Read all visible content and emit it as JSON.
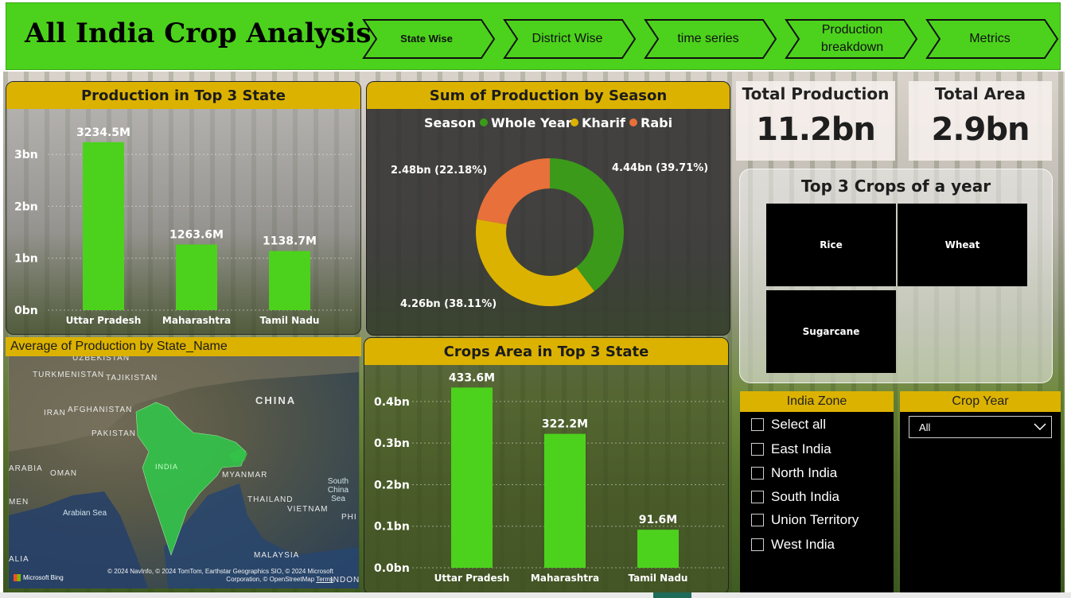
{
  "header": {
    "title": "All India Crop Analysis",
    "nav": [
      "State Wise",
      "District Wise",
      "time series",
      "Production breakdown",
      "Metrics"
    ]
  },
  "colors": {
    "header_green": "#4cd21c",
    "panel_gold": "#dcb200",
    "bar_green": "#4cd21c",
    "whole_year": "#3c9a1a",
    "kharif": "#dcb200",
    "rabi": "#e8703a"
  },
  "production_panel": {
    "title": "Production in Top 3 State"
  },
  "season_panel": {
    "title": "Sum of Production by Season"
  },
  "area_panel": {
    "title": "Crops Area in Top 3 State"
  },
  "chart_data": [
    {
      "type": "bar",
      "title": "Production in Top 3 State",
      "categories": [
        "Uttar Pradesh",
        "Maharashtra",
        "Tamil Nadu"
      ],
      "values": [
        3234.5,
        1263.6,
        1138.7
      ],
      "data_labels": [
        "3234.5M",
        "1263.6M",
        "1138.7M"
      ],
      "yticks": [
        "0bn",
        "1bn",
        "2bn",
        "3bn"
      ],
      "ylim": [
        0,
        3.4
      ],
      "grid": true
    },
    {
      "type": "pie",
      "title": "Sum of Production by Season",
      "legend_title": "Season",
      "legend_position": "top",
      "labels": [
        "Whole Year",
        "Kharif",
        "Rabi"
      ],
      "values": [
        4.44,
        4.26,
        2.48
      ],
      "percents": [
        39.71,
        38.11,
        22.18
      ],
      "data_labels": [
        "4.44bn (39.71%)",
        "4.26bn (38.11%)",
        "2.48bn (22.18%)"
      ]
    },
    {
      "type": "bar",
      "title": "Crops Area in Top 3 State",
      "categories": [
        "Uttar Pradesh",
        "Maharashtra",
        "Tamil Nadu"
      ],
      "values": [
        433.6,
        322.2,
        91.6
      ],
      "data_labels": [
        "433.6M",
        "322.2M",
        "91.6M"
      ],
      "yticks": [
        "0.0bn",
        "0.1bn",
        "0.2bn",
        "0.3bn",
        "0.4bn"
      ],
      "ylim": [
        0,
        0.44
      ],
      "grid": true
    }
  ],
  "map": {
    "title": "Average of Production by State_Name",
    "labels": [
      "UZBEKISTAN",
      "TURKMENISTAN",
      "TAJIKISTAN",
      "CHINA",
      "IRAN",
      "AFGHANISTAN",
      "PAKISTAN",
      "INDIA",
      "ARABIA",
      "OMAN",
      "MYANMAR",
      "South China Sea",
      "THAILAND",
      "VIETNAM",
      "Arabian Sea",
      "MEN",
      "PHI",
      "MALAYSIA",
      "ALIA",
      "INDONES"
    ],
    "attribution": "© 2024 NavInfo, © 2024 TomTom, Earthstar Geographics SIO, © 2024 Microsoft Corporation, © OpenStreetMap",
    "terms": "Terms",
    "provider": "Microsoft Bing"
  },
  "kpis": [
    {
      "label": "Total Production",
      "value": "11.2bn"
    },
    {
      "label": "Total Area",
      "value": "2.9bn"
    }
  ],
  "top_crops": {
    "title": "Top 3 Crops of a year",
    "crops": [
      "Rice",
      "Wheat",
      "Sugarcane"
    ]
  },
  "zone_slicer": {
    "title": "India Zone",
    "options": [
      "Select all",
      "East India",
      "North India",
      "South India",
      "Union Territory",
      "West India"
    ]
  },
  "year_slicer": {
    "title": "Crop Year",
    "selected": "All"
  }
}
